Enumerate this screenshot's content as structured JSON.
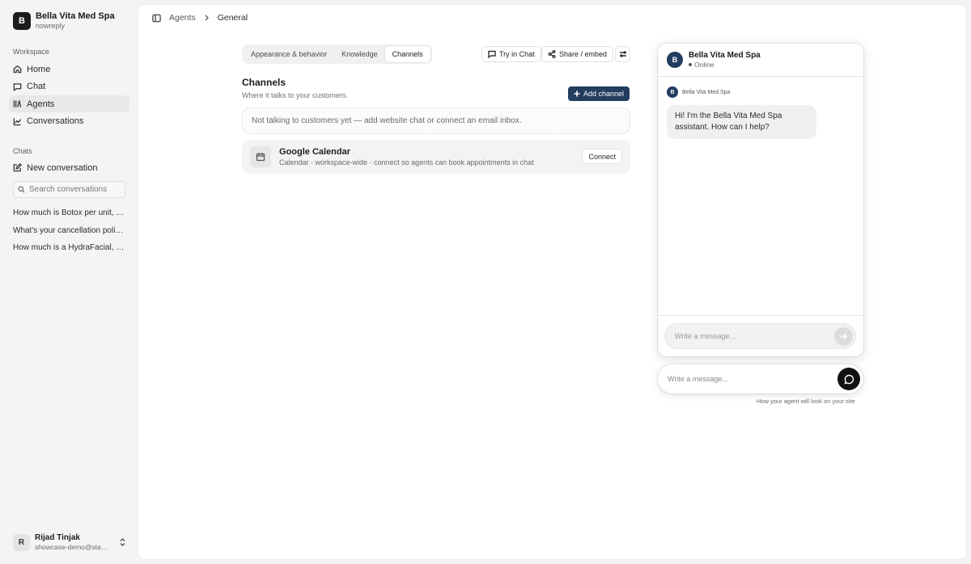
{
  "workspace": {
    "logo_letter": "B",
    "name": "Bella Vita Med Spa",
    "sub": "nowreply"
  },
  "sidebar": {
    "workspace_label": "Workspace",
    "nav": [
      {
        "label": "Home",
        "icon": "home-icon"
      },
      {
        "label": "Chat",
        "icon": "chat-bubble-icon"
      },
      {
        "label": "Agents",
        "icon": "agents-icon",
        "active": true
      },
      {
        "label": "Conversations",
        "icon": "chart-icon"
      }
    ],
    "chats_label": "Chats",
    "new_conversation": "New conversation",
    "search_placeholder": "Search conversations",
    "chats": [
      "How much is Botox per unit, an…",
      "What's your cancellation policy,…",
      "How much is a HydraFacial, an…"
    ]
  },
  "user": {
    "initial": "R",
    "name": "Rijad Tinjak",
    "email": "showcase-demo@star…"
  },
  "breadcrumb": {
    "parent": "Agents",
    "current": "General"
  },
  "tabs": [
    {
      "label": "Appearance & behavior"
    },
    {
      "label": "Knowledge"
    },
    {
      "label": "Channels",
      "active": true
    }
  ],
  "toolbar": {
    "try_chat": "Try in Chat",
    "share_embed": "Share / embed"
  },
  "channels": {
    "title": "Channels",
    "subtitle": "Where it talks to your customers.",
    "add_label": "Add channel",
    "empty_message": "Not talking to customers yet — add website chat or connect an email inbox.",
    "calendar": {
      "name": "Google Calendar",
      "description": "Calendar · workspace-wide · connect so agents can book appointments in chat",
      "connect_label": "Connect"
    }
  },
  "preview": {
    "avatar_letter": "B",
    "agent_name": "Bella Vita Med Spa",
    "status": "Online",
    "message_sender": "Bella Vita Med Spa",
    "greeting": "Hi! I'm the Bella Vita Med Spa assistant. How can I help?",
    "input_placeholder": "Write a message…",
    "launcher_placeholder": "Write a message...",
    "caption": "How your agent will look on your site"
  },
  "colors": {
    "brand": "#223d5f",
    "launcher": "#111111"
  }
}
